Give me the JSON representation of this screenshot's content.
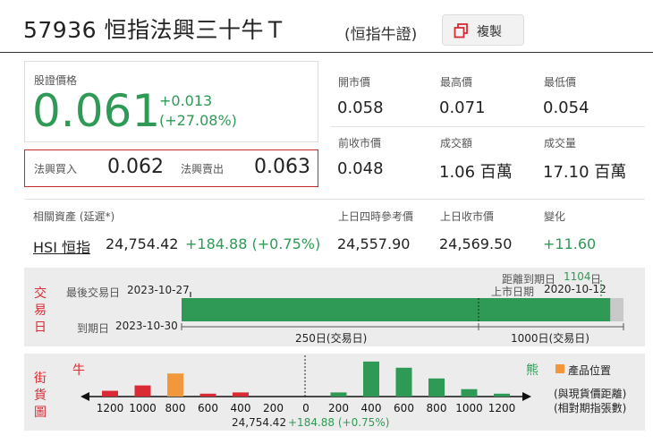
{
  "header": {
    "title": "57936 恒指法興三十牛Ｔ",
    "subtitle": "(恒指牛證)",
    "copy_label": "複製"
  },
  "quote": {
    "price_label": "股證價格",
    "price": "0.061",
    "change": "+0.013",
    "change_pct": "(+27.08%)",
    "bid_label": "法興買入",
    "bid": "0.062",
    "ask_label": "法興賣出",
    "ask": "0.063"
  },
  "stats": [
    {
      "label": "開市價",
      "value": "0.058"
    },
    {
      "label": "最高價",
      "value": "0.071"
    },
    {
      "label": "最低價",
      "value": "0.054"
    },
    {
      "label": "前收市價",
      "value": "0.048"
    },
    {
      "label": "成交額",
      "value": "1.06 百萬"
    },
    {
      "label": "成交量",
      "value": "17.10 百萬"
    }
  ],
  "underlying": {
    "label": "相關資產 (延遲*)",
    "name": "HSI 恒指",
    "price": "24,754.42",
    "change": "+184.88 (+0.75%)",
    "ref_label": "上日四時參考價",
    "ref_value": "24,557.90",
    "close_label": "上日收市價",
    "close_value": "24,569.50",
    "diff_label": "變化",
    "diff_value": "+11.60"
  },
  "timeline": {
    "side_label": [
      "交",
      "易",
      "日"
    ],
    "last_trade_label": "最後交易日",
    "last_trade_date": "2023-10-27",
    "expiry_label": "到期日",
    "expiry_date": "2023-10-30",
    "days_to_expiry_label": "距離到期日",
    "days_to_expiry_value": "1104",
    "days_to_expiry_unit": "日",
    "listing_label": "上市日期",
    "listing_date": "2020-10-12",
    "span1_label": "250日(交易日)",
    "span2_label": "1000日(交易日)",
    "elapsed_fraction": 0.97,
    "colors": {
      "bar": "#2e9a55",
      "rest": "#c9c9c9"
    }
  },
  "heatmap": {
    "side_label": [
      "街",
      "貨",
      "圖"
    ],
    "bull_label": "牛",
    "bear_label": "熊",
    "legend_label": "產品位置",
    "note1": "(與現貨價距離)",
    "note2": "(相對期指張數)",
    "bottom_label_price": "24,754.42",
    "bottom_label_change": "+184.88 (+0.75%)",
    "colors": {
      "bull": "#d92a35",
      "bear": "#2e9a55",
      "highlight": "#f2973b"
    }
  },
  "chart_data": {
    "type": "bar",
    "categories": [
      "1200",
      "1000",
      "800",
      "600",
      "400",
      "200",
      "0",
      "200",
      "400",
      "600",
      "800",
      "1000",
      "1200"
    ],
    "series": [
      {
        "name": "牛",
        "values": [
          0.14,
          0.27,
          0.56,
          0.07,
          0.1,
          0,
          null,
          null,
          null,
          null,
          null,
          null,
          null
        ]
      },
      {
        "name": "熊",
        "values": [
          null,
          null,
          null,
          null,
          null,
          null,
          null,
          0.1,
          0.85,
          0.7,
          0.44,
          0.18,
          0.07
        ]
      }
    ],
    "highlight_index": 2,
    "legend": "產品位置",
    "ylim": [
      0,
      1
    ]
  }
}
